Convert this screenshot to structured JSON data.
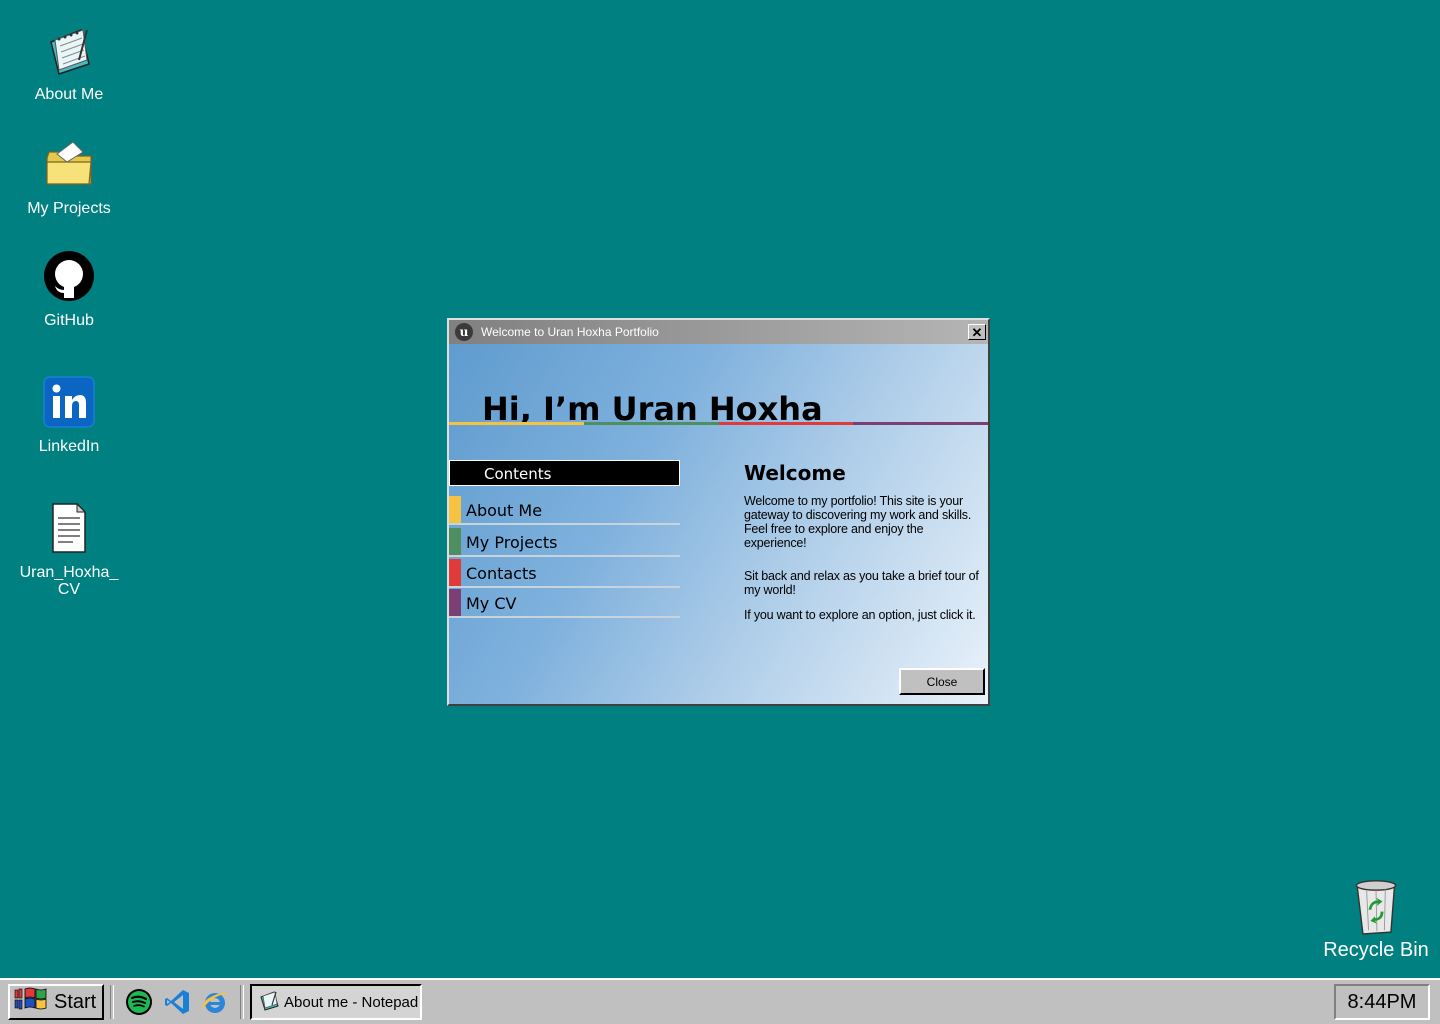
{
  "desktop": {
    "icons": [
      {
        "label": "About Me",
        "icon": "notepad-icon"
      },
      {
        "label": "My Projects",
        "icon": "folder-icon"
      },
      {
        "label": "GitHub",
        "icon": "github-icon"
      },
      {
        "label": "LinkedIn",
        "icon": "linkedin-icon"
      },
      {
        "label": "Uran_Hoxha_CV",
        "icon": "document-icon"
      }
    ],
    "recycle_bin": {
      "label": "Recycle Bin",
      "icon": "recycle-bin-icon"
    },
    "background_color": "#008080"
  },
  "dialog": {
    "title": "Welcome to Uran Hoxha Portfolio",
    "logo_letter": "u",
    "close_glyph": "✕",
    "heading": "Hi, I’m Uran Hoxha",
    "rule_colors": [
      "#f5c242",
      "#4f8f5f",
      "#e03a3a",
      "#7a3f73"
    ],
    "contents_label": "Contents",
    "menu": [
      {
        "label": "About Me",
        "color": "#f5c242"
      },
      {
        "label": "My Projects",
        "color": "#4f8f5f"
      },
      {
        "label": "Contacts",
        "color": "#e03a3a"
      },
      {
        "label": "My CV",
        "color": "#7a3f73"
      }
    ],
    "welcome_title": "Welcome",
    "paragraphs": [
      "Welcome to my portfolio! This site is your gateway to discovering my work and skills. Feel free to explore and enjoy the experience!",
      "Sit back and relax as you take a brief tour of my world!",
      "If you want to explore an option, just click it."
    ],
    "close_button": "Close"
  },
  "taskbar": {
    "start_label": "Start",
    "quick_launch": [
      "spotify-icon",
      "vscode-icon",
      "internet-explorer-icon"
    ],
    "task_label": "About me - Notepad",
    "clock": "8:44PM"
  }
}
